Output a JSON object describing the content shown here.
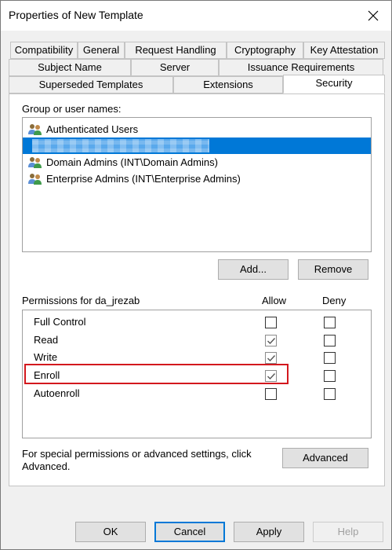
{
  "window": {
    "title": "Properties of New Template"
  },
  "tabs": {
    "row1": [
      "Compatibility",
      "General",
      "Request Handling",
      "Cryptography",
      "Key Attestation"
    ],
    "row2": [
      "Subject Name",
      "Server",
      "Issuance Requirements"
    ],
    "row3": [
      "Superseded Templates",
      "Extensions",
      "Security"
    ],
    "active": "Security"
  },
  "security": {
    "group_label": "Group or user names:",
    "groups": [
      {
        "name": "Authenticated Users",
        "selected": false,
        "icon": "users-icon"
      },
      {
        "name": "",
        "selected": true,
        "icon": "none",
        "note": "pixelated"
      },
      {
        "name": "Domain Admins (INT\\Domain Admins)",
        "selected": false,
        "icon": "users-icon"
      },
      {
        "name": "Enterprise Admins (INT\\Enterprise Admins)",
        "selected": false,
        "icon": "users-icon"
      }
    ],
    "add_label": "Add...",
    "remove_label": "Remove",
    "permissions_label": "Permissions for da_jrezab",
    "allow_header": "Allow",
    "deny_header": "Deny",
    "permissions": [
      {
        "name": "Full Control",
        "allow": false,
        "deny": false,
        "allow_dimmed": false
      },
      {
        "name": "Read",
        "allow": true,
        "deny": false,
        "allow_dimmed": true
      },
      {
        "name": "Write",
        "allow": true,
        "deny": false,
        "allow_dimmed": true
      },
      {
        "name": "Enroll",
        "allow": true,
        "deny": false,
        "allow_dimmed": true,
        "highlighted": true
      },
      {
        "name": "Autoenroll",
        "allow": false,
        "deny": false,
        "allow_dimmed": false
      }
    ],
    "advanced_text": "For special permissions or advanced settings, click Advanced.",
    "advanced_label": "Advanced"
  },
  "footer": {
    "ok_label": "OK",
    "cancel_label": "Cancel",
    "apply_label": "Apply",
    "help_label": "Help"
  },
  "colors": {
    "selection": "#0078d7",
    "highlight_border": "#d3181e"
  }
}
